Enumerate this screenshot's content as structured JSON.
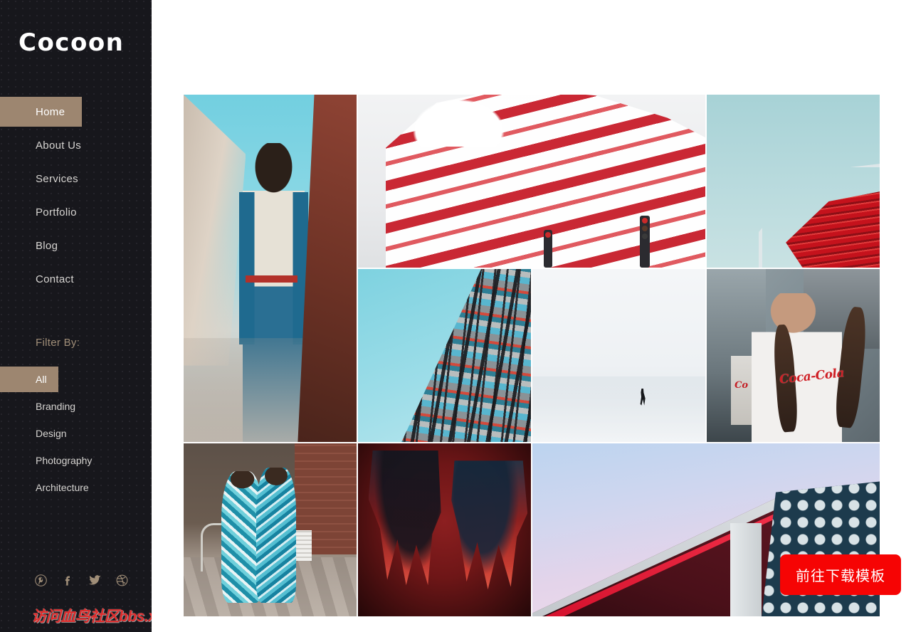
{
  "brand": {
    "name": "Cocoon"
  },
  "nav": {
    "items": [
      {
        "label": "Home",
        "active": true
      },
      {
        "label": "About Us",
        "active": false
      },
      {
        "label": "Services",
        "active": false
      },
      {
        "label": "Portfolio",
        "active": false
      },
      {
        "label": "Blog",
        "active": false
      },
      {
        "label": "Contact",
        "active": false
      }
    ]
  },
  "filter": {
    "heading": "Filter By:",
    "items": [
      {
        "label": "All",
        "active": true
      },
      {
        "label": "Branding",
        "active": false
      },
      {
        "label": "Design",
        "active": false
      },
      {
        "label": "Photography",
        "active": false
      },
      {
        "label": "Architecture",
        "active": false
      }
    ]
  },
  "socials": [
    {
      "name": "pinterest-icon"
    },
    {
      "name": "facebook-icon"
    },
    {
      "name": "twitter-icon"
    },
    {
      "name": "dribbble-icon"
    }
  ],
  "watermark": {
    "text": "访问血鸟社区bbs.xieniao.com免费下载更多网页"
  },
  "download_button": {
    "label": "前往下载模板"
  },
  "colors": {
    "sidebar_bg": "#17171c",
    "accent_tan": "#9d8670",
    "nav_text": "#d6d4d1",
    "filter_heading": "#a08e78",
    "main_bg": "#ffffff",
    "watermark_red": "#e02b2b",
    "download_red": "#f60404"
  },
  "gallery": {
    "tiles": [
      {
        "id": "man-in-street",
        "alt": "Man in blue suit walking down street"
      },
      {
        "id": "red-white-wavy-building",
        "alt": "Red and white wavy museum facade"
      },
      {
        "id": "teal-sky-red-roof",
        "alt": "Teal sky with red louvered roof"
      },
      {
        "id": "curved-facade",
        "alt": "Curved colorful building facade"
      },
      {
        "id": "lone-walker-snow",
        "alt": "Lone walker in white snowy landscape"
      },
      {
        "id": "coca-cola-woman",
        "alt": "Woman in Coca-Cola shirt"
      },
      {
        "id": "street-style-pair",
        "alt": "Two people in blue print outfits walking"
      },
      {
        "id": "red-lit-hands",
        "alt": "Two hands lit in red and blue"
      },
      {
        "id": "architecture-corner",
        "alt": "Building corner against pastel gradient sky"
      }
    ]
  }
}
